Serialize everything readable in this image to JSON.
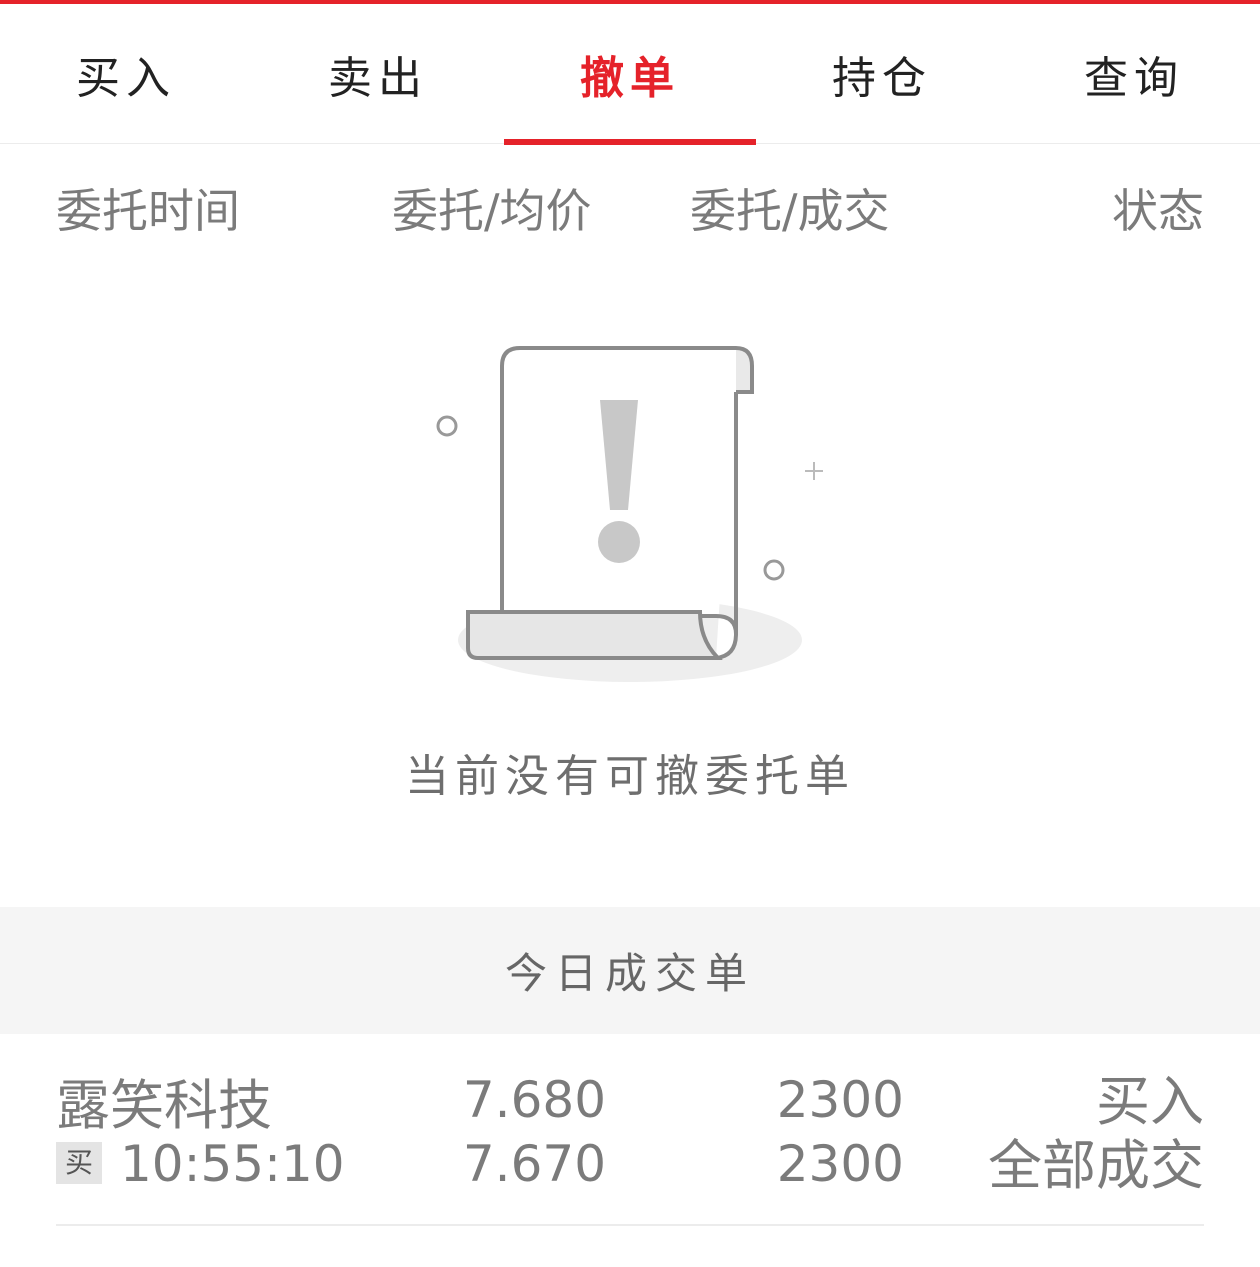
{
  "colors": {
    "accent": "#e5222a",
    "text_gray": "#7b7b7b"
  },
  "tabs": [
    {
      "label": "买入"
    },
    {
      "label": "卖出"
    },
    {
      "label": "撤单",
      "active": true
    },
    {
      "label": "持仓"
    },
    {
      "label": "查询"
    }
  ],
  "columns": {
    "time": "委托时间",
    "price": "委托/均价",
    "qty": "委托/成交",
    "status": "状态"
  },
  "empty_state": {
    "icon": "warning-document-icon",
    "message": "当前没有可撤委托单"
  },
  "section": {
    "title": "今日成交单"
  },
  "trades": [
    {
      "name": "露笑科技",
      "side_badge": "买",
      "time": "10:55:10",
      "order_price": "7.680",
      "avg_price": "7.670",
      "order_qty": "2300",
      "filled_qty": "2300",
      "direction": "买入",
      "status": "全部成交"
    }
  ]
}
